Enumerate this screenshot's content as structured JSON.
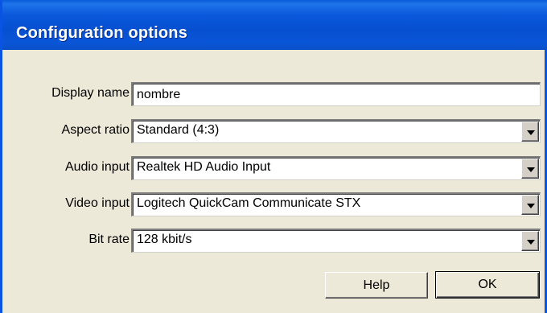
{
  "window": {
    "title": "Configuration options"
  },
  "form": {
    "display_name": {
      "label": "Display name",
      "value": "nombre"
    },
    "aspect_ratio": {
      "label": "Aspect ratio",
      "value": "Standard (4:3)"
    },
    "audio_input": {
      "label": "Audio input",
      "value": "Realtek HD Audio Input"
    },
    "video_input": {
      "label": "Video input",
      "value": "Logitech QuickCam Communicate STX"
    },
    "bit_rate": {
      "label": "Bit rate",
      "value": "128 kbit/s"
    }
  },
  "buttons": {
    "help": "Help",
    "ok": "OK"
  },
  "colors": {
    "titlebar": "#0a58dc",
    "dialog_bg": "#ece9d8"
  }
}
